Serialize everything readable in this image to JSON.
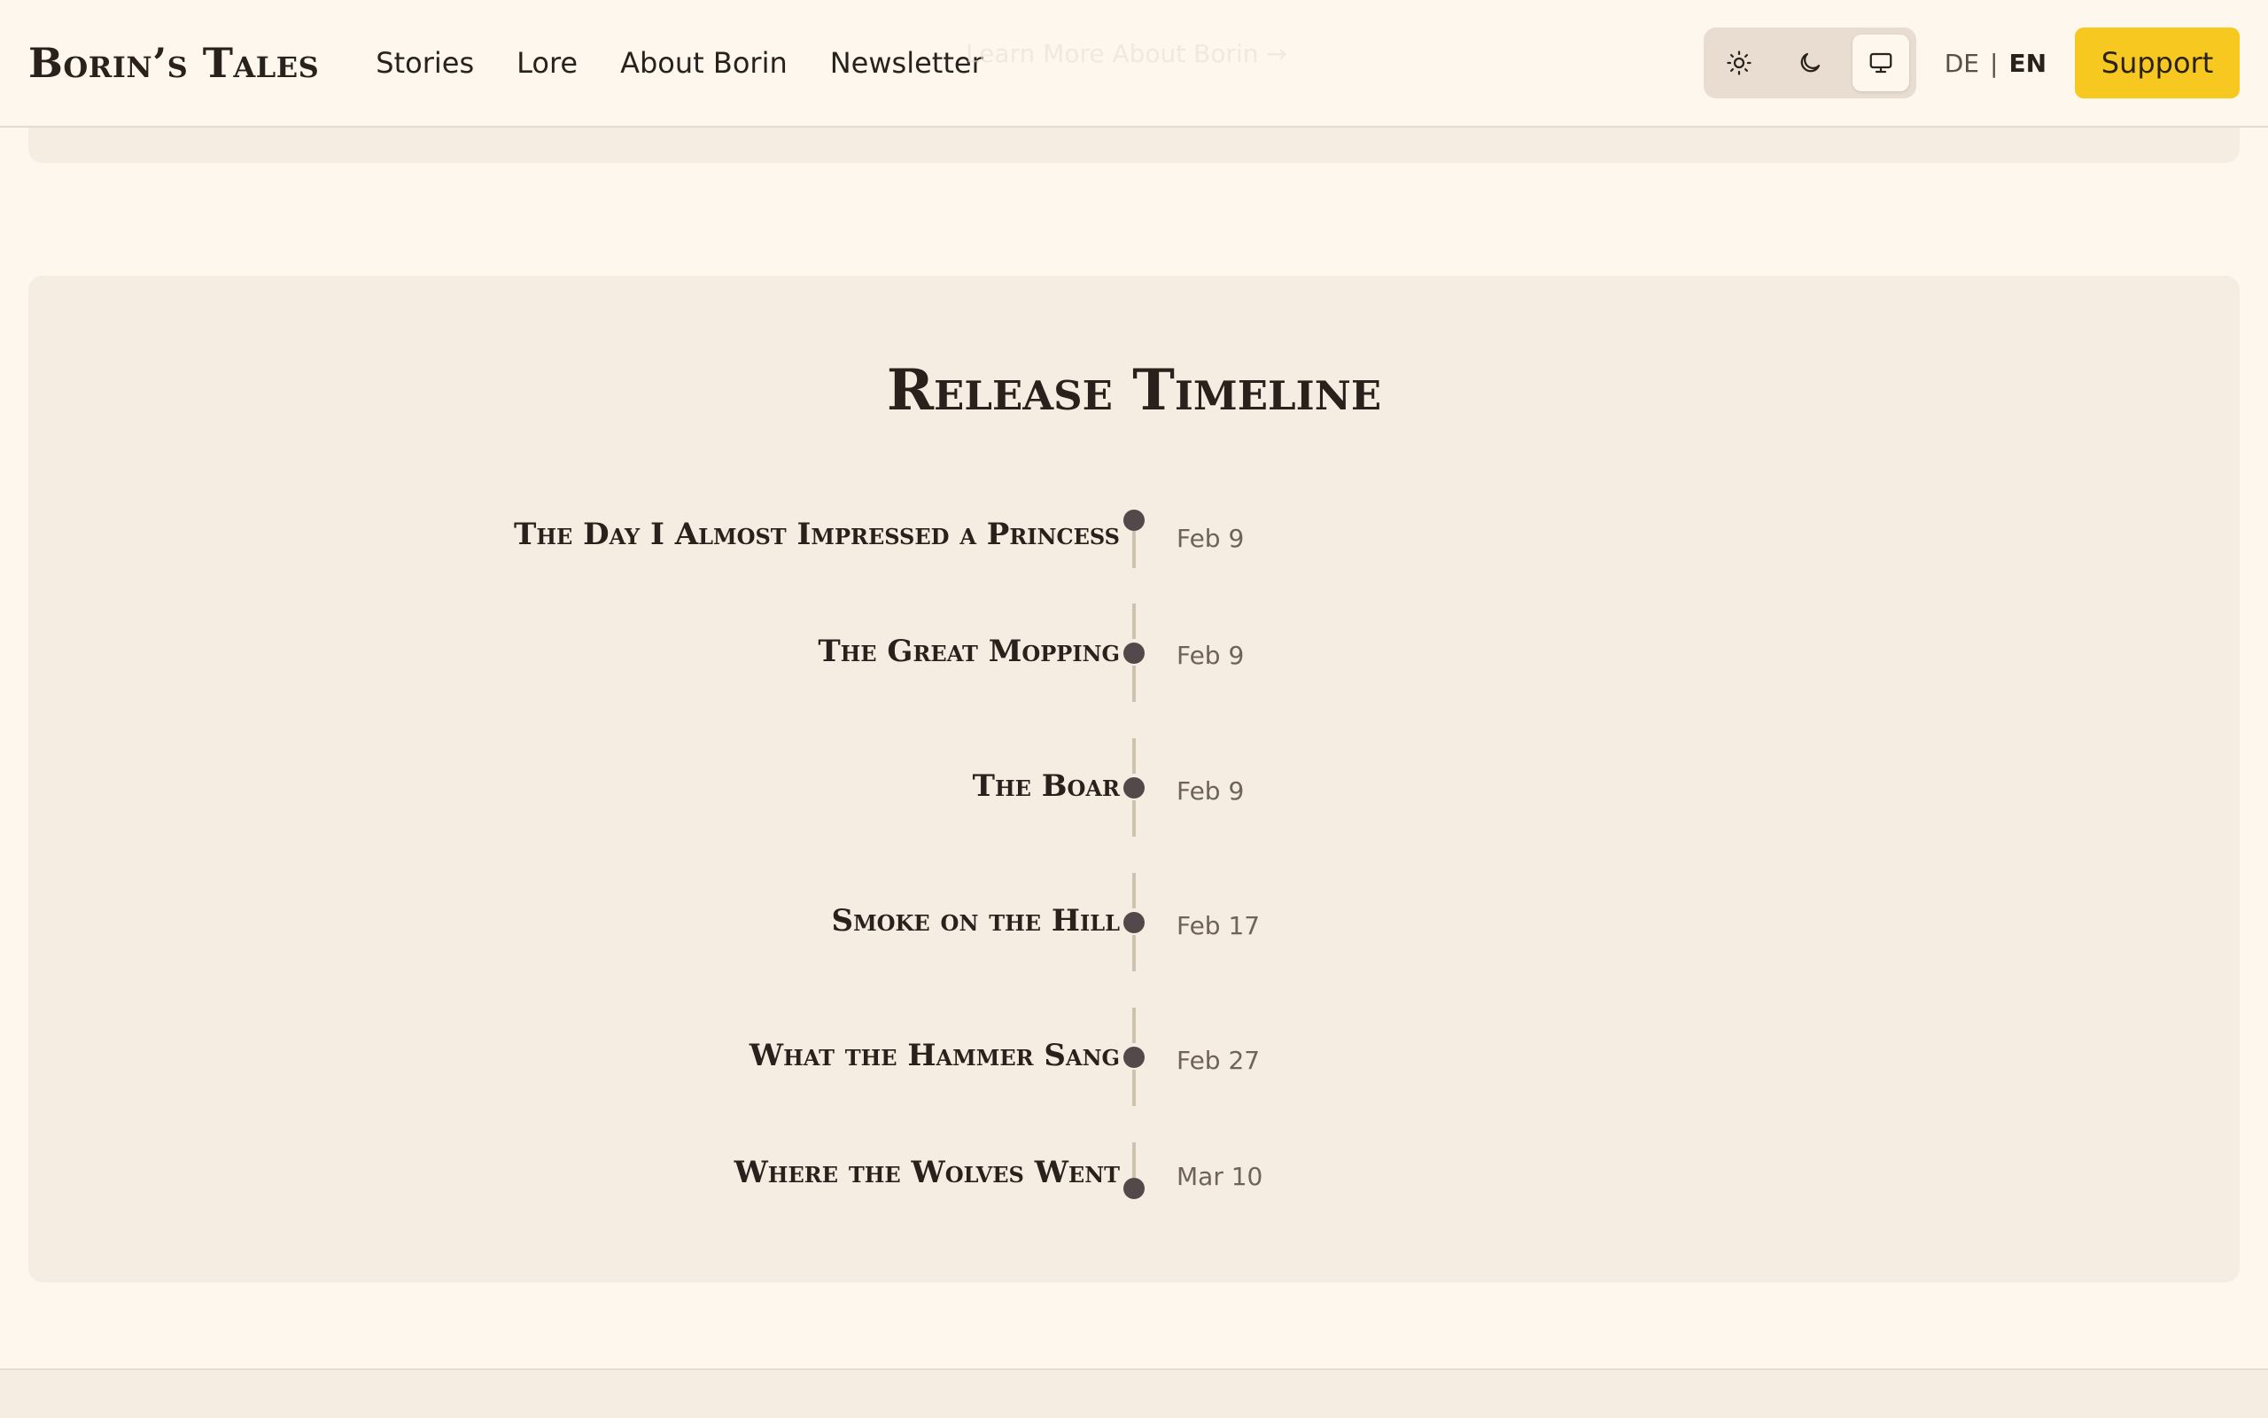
{
  "header": {
    "logo": "Borin’s Tales",
    "nav": [
      "Stories",
      "Lore",
      "About Borin",
      "Newsletter"
    ],
    "ghost_text": "Learn More About Borin →",
    "theme_options": [
      "light",
      "dark",
      "system"
    ],
    "theme_active": "system",
    "lang": {
      "de": "DE",
      "separator": "|",
      "en": "EN",
      "active": "EN"
    },
    "support_label": "Support"
  },
  "timeline": {
    "title": "Release Timeline",
    "items": [
      {
        "title": "The Day I Almost Impressed a Princess",
        "date": "Feb 9"
      },
      {
        "title": "The Great Mopping",
        "date": "Feb 9"
      },
      {
        "title": "The Boar",
        "date": "Feb 9"
      },
      {
        "title": "Smoke on the Hill",
        "date": "Feb 17"
      },
      {
        "title": "What the Hammer Sang",
        "date": "Feb 27"
      },
      {
        "title": "Where the Wolves Went",
        "date": "Mar 10"
      }
    ]
  },
  "colors": {
    "page_bg": "#fdf7ee",
    "card_bg": "#f5ede2",
    "accent": "#f7c820",
    "text": "#2a211c",
    "dot": "#54494a",
    "line": "#cfc2ae"
  }
}
